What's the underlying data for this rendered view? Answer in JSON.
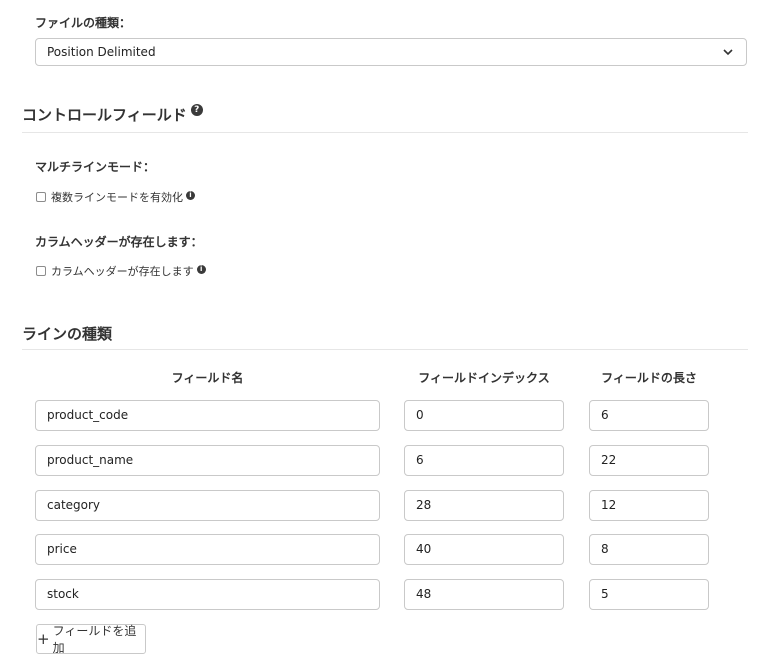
{
  "file_type": {
    "label": "ファイルの種類：",
    "selected": "Position Delimited"
  },
  "control_fields": {
    "title": "コントロールフィールド",
    "multiline": {
      "label": "マルチラインモード：",
      "checkbox_label": "複数ラインモードを有効化",
      "checked": false
    },
    "header": {
      "label": "カラムヘッダーが存在します：",
      "checkbox_label": "カラムヘッダーが存在します",
      "checked": false
    }
  },
  "line_type": {
    "title": "ラインの種類",
    "columns": [
      "フィールド名",
      "フィールドインデックス",
      "フィールドの長さ"
    ],
    "rows": [
      {
        "name": "product_code",
        "index": "0",
        "length": "6"
      },
      {
        "name": "product_name",
        "index": "6",
        "length": "22"
      },
      {
        "name": "category",
        "index": "28",
        "length": "12"
      },
      {
        "name": "price",
        "index": "40",
        "length": "8"
      },
      {
        "name": "stock",
        "index": "48",
        "length": "5"
      }
    ],
    "add_button_label": "フィールドを追加"
  },
  "icons": {
    "help": "question-circle-icon",
    "info": "info-circle-icon",
    "select": "chevron-down-icon",
    "add": "plus-icon"
  }
}
